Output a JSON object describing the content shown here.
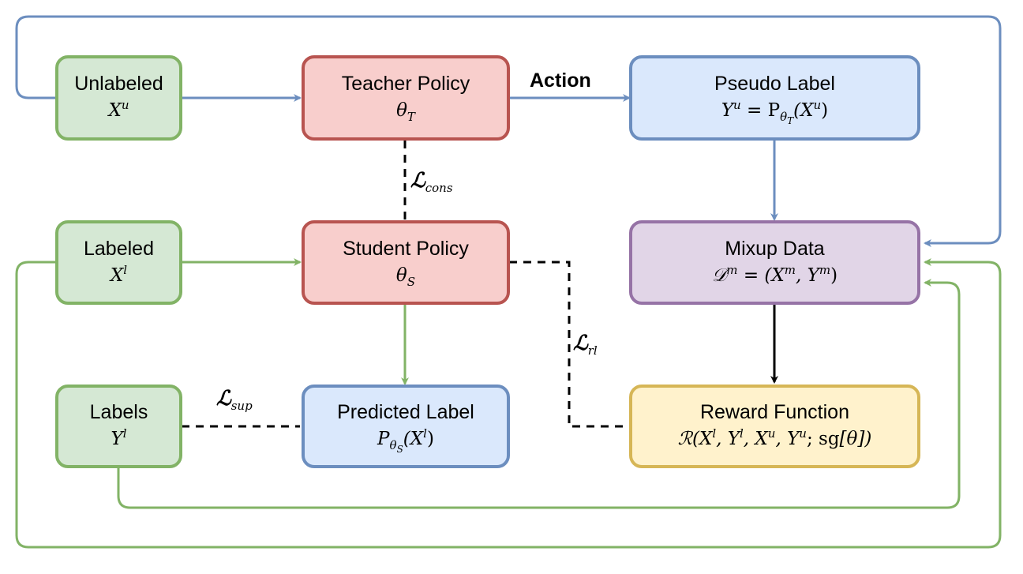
{
  "diagram": {
    "title": "Teacher-Student policy semi-supervised learning with mixup and reward function",
    "colors": {
      "green_fill": "#d5e8d4",
      "green_stroke": "#82b366",
      "red_fill": "#f8cecc",
      "red_stroke": "#b85450",
      "blue_fill": "#dae8fc",
      "blue_stroke": "#6c8ebf",
      "purple_fill": "#e1d5e7",
      "purple_stroke": "#9673a6",
      "yellow_fill": "#fff2cc",
      "yellow_stroke": "#d6b656",
      "edge_black": "#000000"
    },
    "nodes": {
      "unlabeled": {
        "title": "Unlabeled",
        "math_base": "X",
        "math_sup": "u"
      },
      "teacher": {
        "title": "Teacher Policy",
        "math_base": "θ",
        "math_sub": "T"
      },
      "pseudo": {
        "title": "Pseudo Label",
        "math_lhs": "Y",
        "math_lhs_sup": "u",
        "math_eq": " = P",
        "math_sub": "θ",
        "math_sub_sub": "T",
        "math_arg": "(X",
        "math_arg_sup": "u",
        "math_close": ")"
      },
      "labeled": {
        "title": "Labeled",
        "math_base": "X",
        "math_sup": "l"
      },
      "student": {
        "title": "Student Policy",
        "math_base": "θ",
        "math_sub": "S"
      },
      "mixup": {
        "title": "Mixup Data",
        "math_base": "𝒟",
        "math_sup": "m",
        "math_eq": " = (X",
        "math_sup2": "m",
        "math_mid": ", Y",
        "math_sup3": "m",
        "math_close": ")"
      },
      "labels": {
        "title": "Labels",
        "math_base": "Y",
        "math_sup": "l"
      },
      "predicted": {
        "title": "Predicted Label",
        "math_base": "P",
        "math_sub": "θ",
        "math_sub_sub": "S",
        "math_arg": "(X",
        "math_arg_sup": "l",
        "math_close": ")"
      },
      "reward": {
        "title": "Reward Function",
        "math_r": "ℛ(X",
        "sup1": "l",
        "t1": ", Y",
        "sup2": "l",
        "t2": ", X",
        "sup3": "u",
        "t3": ", Y",
        "sup4": "u",
        "t4": "; ",
        "sg": "sg",
        "t5": "[θ])"
      }
    },
    "edges": {
      "action_label": "Action",
      "loss_cons": {
        "base": "ℒ",
        "sub": "cons"
      },
      "loss_rl": {
        "base": "ℒ",
        "sub": "rl"
      },
      "loss_sup": {
        "base": "ℒ",
        "sub": "sup"
      }
    }
  }
}
